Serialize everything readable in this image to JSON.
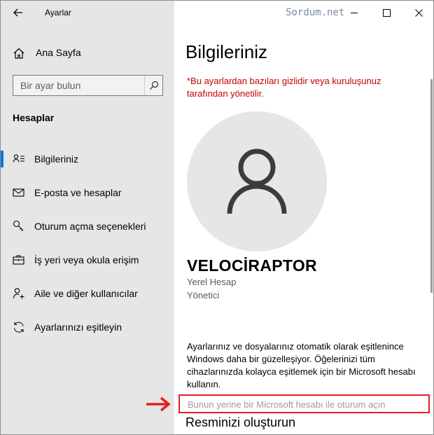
{
  "app": {
    "title": "Ayarlar",
    "watermark": "Sordum.net"
  },
  "sidebar": {
    "home_label": "Ana Sayfa",
    "search_placeholder": "Bir ayar bulun",
    "section_title": "Hesaplar",
    "items": [
      {
        "label": "Bilgileriniz",
        "icon": "user-card-icon",
        "active": true
      },
      {
        "label": "E-posta ve hesaplar",
        "icon": "mail-icon",
        "active": false
      },
      {
        "label": "Oturum açma seçenekleri",
        "icon": "key-icon",
        "active": false
      },
      {
        "label": "İş yeri veya okula erişim",
        "icon": "briefcase-icon",
        "active": false
      },
      {
        "label": "Aile ve diğer kullanıcılar",
        "icon": "add-user-icon",
        "active": false
      },
      {
        "label": "Ayarlarınızı eşitleyin",
        "icon": "sync-icon",
        "active": false
      }
    ]
  },
  "main": {
    "title": "Bilgileriniz",
    "policy_note": "*Bu ayarlardan bazıları gizlidir veya kuruluşunuz tarafından yönetilir.",
    "user_name": "VELOCİRAPTOR",
    "account_type": "Yerel Hesap",
    "account_role": "Yönetici",
    "sync_text": "Ayarlarınız ve dosyalarınız otomatik olarak eşitlenince Windows daha bir güzelleşiyor. Öğelerinizi tüm cihazlarınızda kolayca eşitlemek için bir Microsoft hesabı kullanın.",
    "ms_link": "Bunun yerine bir Microsoft hesabı ile oturum açın",
    "picture_title": "Resminizi oluşturun"
  },
  "colors": {
    "accent": "#0078d7",
    "sidebar_bg": "#e6e6e6",
    "warning_red": "#c50000",
    "highlight_red": "#e02020"
  }
}
